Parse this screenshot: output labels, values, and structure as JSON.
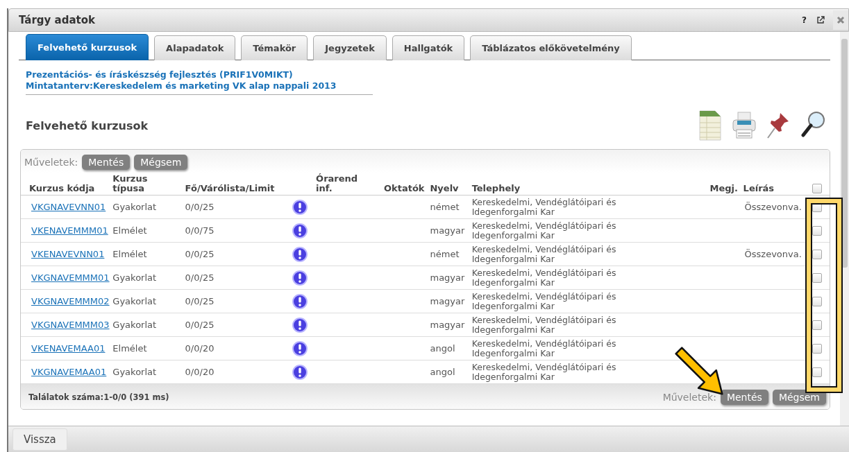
{
  "window": {
    "title": "Tárgy adatok",
    "help_label": "?"
  },
  "tabs": [
    {
      "label": "Felvehető kurzusok",
      "selected": true
    },
    {
      "label": "Alapadatok",
      "selected": false
    },
    {
      "label": "Témakör",
      "selected": false
    },
    {
      "label": "Jegyzetek",
      "selected": false
    },
    {
      "label": "Hallgatók",
      "selected": false
    },
    {
      "label": "Táblázatos előkövetelmény",
      "selected": false
    }
  ],
  "subject_links": [
    "Prezentációs- és íráskészség fejlesztés (PRIF1V0MIKT)",
    "Mintatanterv:Kereskedelem és marketing VK alap nappali 2013"
  ],
  "section_title": "Felvehető kurzusok",
  "toolbar": {
    "label": "Műveletek:",
    "buttons": [
      "Mentés",
      "Mégsem"
    ]
  },
  "table": {
    "columns": [
      "Kurzus kódja",
      "Kurzus típusa",
      "Fő/Várólista/Limit",
      "Órarend inf.",
      "Oktatók",
      "Nyelv",
      "Telephely",
      "Megj.",
      "Leírás"
    ],
    "header_checkbox": {
      "checked": false
    },
    "rows": [
      {
        "code": "VKGNAVEVNN01",
        "type": "Gyakorlat",
        "limit": "0/0/25",
        "language": "német",
        "site": "Kereskedelmi, Vendéglátóipari és Idegenforgalmi Kar",
        "description": "Összevonva.",
        "checked": false
      },
      {
        "code": "VKENAVEMMM01",
        "type": "Elmélet",
        "limit": "0/0/75",
        "language": "magyar",
        "site": "Kereskedelmi, Vendéglátóipari és Idegenforgalmi Kar",
        "checked": false
      },
      {
        "code": "VKENAVEVNN01",
        "type": "Elmélet",
        "limit": "0/0/25",
        "language": "német",
        "site": "Kereskedelmi, Vendéglátóipari és Idegenforgalmi Kar",
        "description": "Összevonva.",
        "checked": false
      },
      {
        "code": "VKGNAVEMMM01",
        "type": "Gyakorlat",
        "limit": "0/0/25",
        "language": "magyar",
        "site": "Kereskedelmi, Vendéglátóipari és Idegenforgalmi Kar",
        "checked": false
      },
      {
        "code": "VKGNAVEMMM02",
        "type": "Gyakorlat",
        "limit": "0/0/25",
        "language": "magyar",
        "site": "Kereskedelmi, Vendéglátóipari és Idegenforgalmi Kar",
        "checked": false
      },
      {
        "code": "VKGNAVEMMM03",
        "type": "Gyakorlat",
        "limit": "0/0/25",
        "language": "magyar",
        "site": "Kereskedelmi, Vendéglátóipari és Idegenforgalmi Kar",
        "checked": false
      },
      {
        "code": "VKENAVEMAA01",
        "type": "Elmélet",
        "limit": "0/0/20",
        "language": "angol",
        "site": "Kereskedelmi, Vendéglátóipari és Idegenforgalmi Kar",
        "checked": false
      },
      {
        "code": "VKGNAVEMAA01",
        "type": "Gyakorlat",
        "limit": "0/0/20",
        "language": "angol",
        "site": "Kereskedelmi, Vendéglátóipari és Idegenforgalmi Kar",
        "checked": false
      }
    ]
  },
  "footer": {
    "results": "Találatok száma:1-0/0 (391 ms)",
    "label": "Műveletek:",
    "buttons": [
      "Mentés",
      "Mégsem"
    ]
  },
  "bottom_bar": {
    "button": "Vissza"
  }
}
